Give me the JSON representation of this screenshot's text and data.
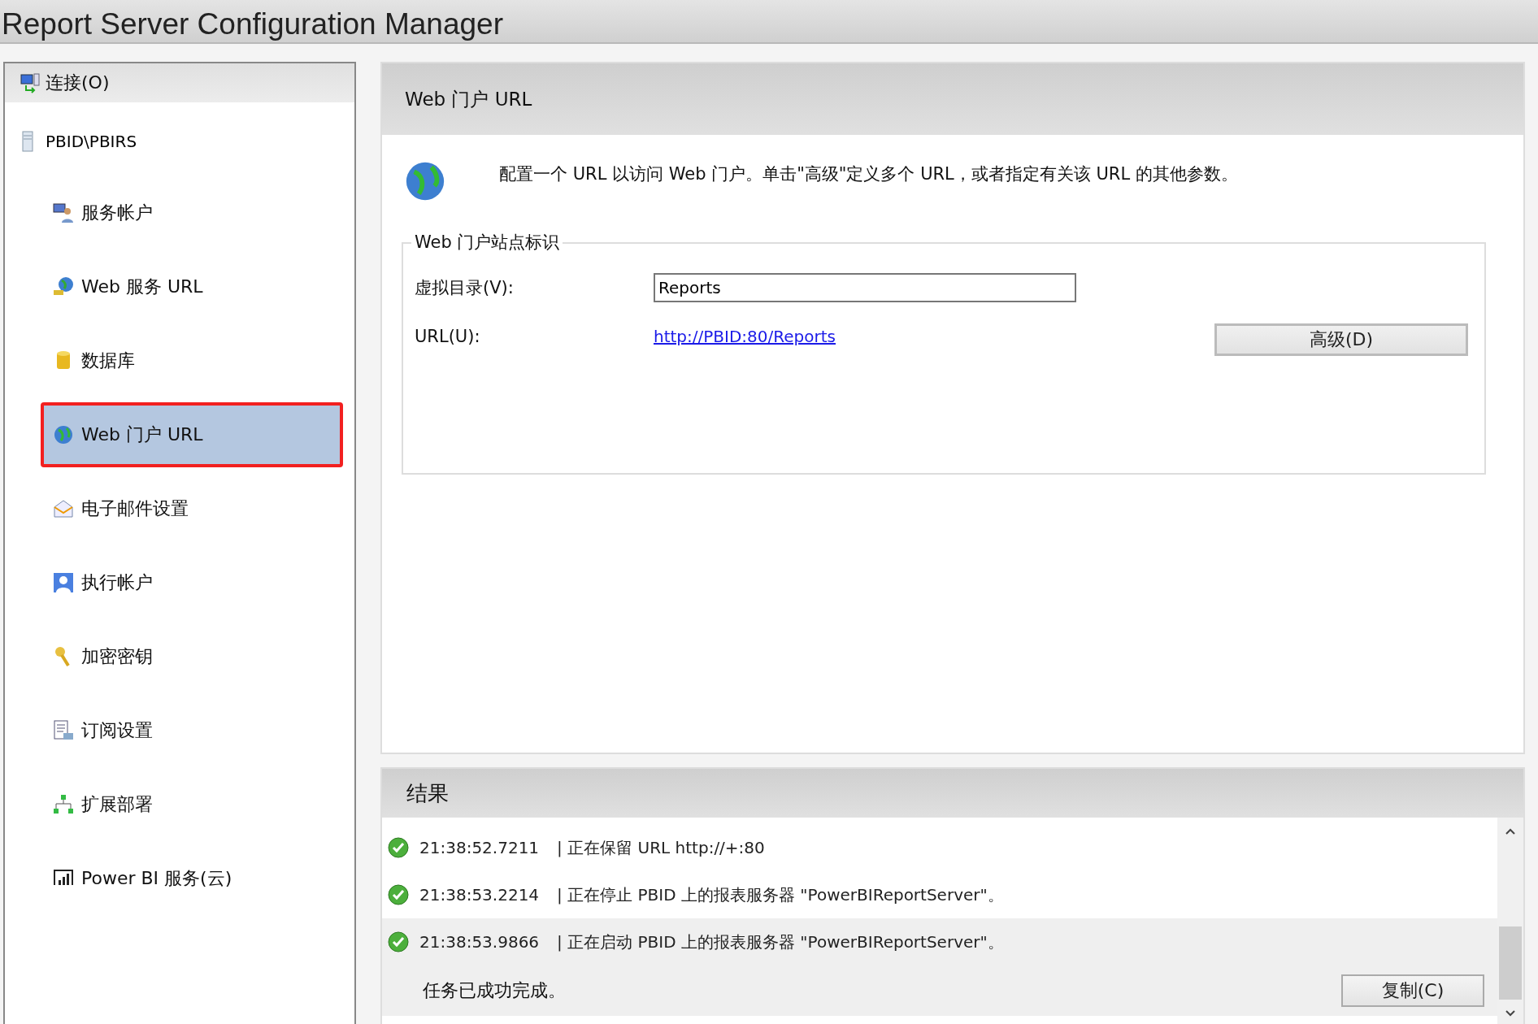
{
  "window": {
    "title": "Report Server Configuration Manager"
  },
  "sidebar": {
    "connect": "连接(O)",
    "server": "PBID\\PBIRS",
    "items": [
      {
        "label": "服务帐户",
        "kind": "user",
        "selected": false
      },
      {
        "label": "Web 服务 URL",
        "kind": "webservice",
        "selected": false
      },
      {
        "label": "数据库",
        "kind": "database",
        "selected": false
      },
      {
        "label": "Web 门户 URL",
        "kind": "globe",
        "selected": true
      },
      {
        "label": "电子邮件设置",
        "kind": "mail",
        "selected": false
      },
      {
        "label": "执行帐户",
        "kind": "person",
        "selected": false
      },
      {
        "label": "加密密钥",
        "kind": "key",
        "selected": false
      },
      {
        "label": "订阅设置",
        "kind": "doc",
        "selected": false
      },
      {
        "label": "扩展部署",
        "kind": "tree",
        "selected": false
      },
      {
        "label": "Power BI 服务(云)",
        "kind": "chart",
        "selected": false
      }
    ]
  },
  "panel": {
    "title": "Web 门户 URL",
    "description": "配置一个 URL 以访问 Web 门户。单击\"高级\"定义多个 URL，或者指定有关该 URL 的其他参数。",
    "group": {
      "title": "Web 门户站点标识",
      "virtual_dir_label": "虚拟目录(V):",
      "virtual_dir_value": "Reports",
      "url_label": "URL(U):",
      "url": "http://PBID:80/Reports",
      "advanced_button": "高级(D)"
    }
  },
  "results": {
    "title": "结果",
    "rows": [
      {
        "time": "21:38:52.7211",
        "message": "| 正在保留 URL http://+:80",
        "selected": false
      },
      {
        "time": "21:38:53.2214",
        "message": "| 正在停止 PBID 上的报表服务器 \"PowerBIReportServer\"。",
        "selected": false
      },
      {
        "time": "21:38:53.9866",
        "message": "| 正在启动 PBID 上的报表服务器 \"PowerBIReportServer\"。",
        "selected": true
      }
    ],
    "summary": "任务已成功完成。",
    "copy_button": "复制(C)"
  }
}
